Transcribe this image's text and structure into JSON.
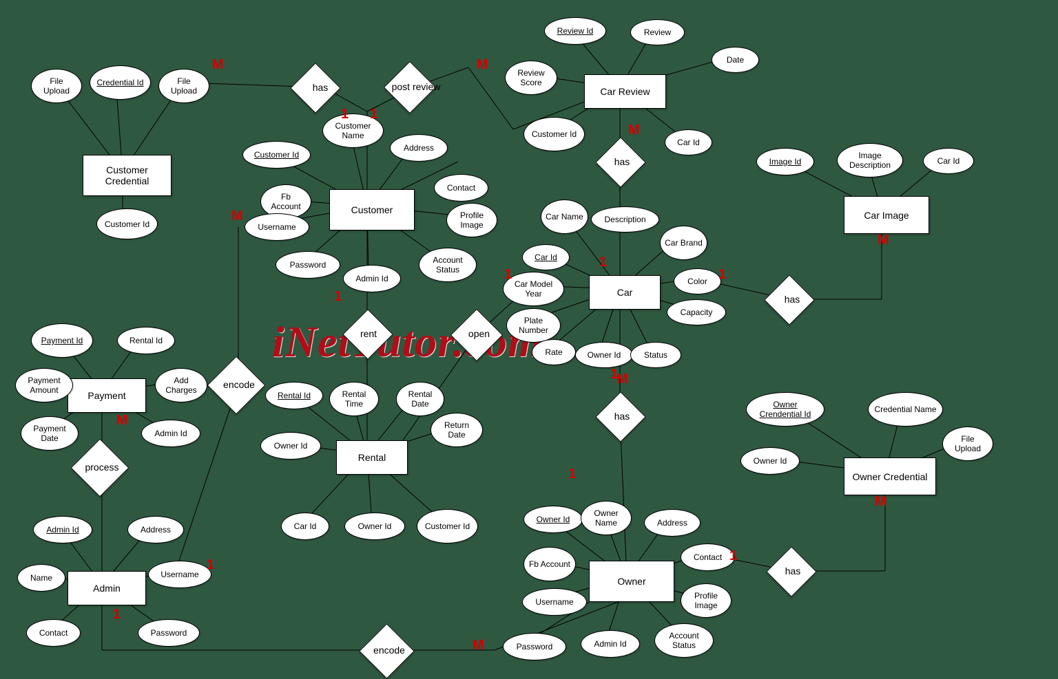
{
  "watermark": "iNetTutor.com",
  "entities": {
    "customer_credential": "Customer Credential",
    "customer": "Customer",
    "car_review": "Car Review",
    "car_image": "Car Image",
    "car": "Car",
    "payment": "Payment",
    "rental": "Rental",
    "admin": "Admin",
    "owner": "Owner",
    "owner_credential": "Owner Credential"
  },
  "relationships": {
    "has1": "has",
    "post_review": "post review",
    "has2": "has",
    "has3": "has",
    "rent": "rent",
    "open": "open",
    "encode1": "encode",
    "process": "process",
    "has4": "has",
    "has5": "has",
    "encode2": "encode"
  },
  "attrs": {
    "cc_file1": "File Upload",
    "cc_credid": "Credential Id",
    "cc_file2": "File Upload",
    "cc_custid": "Customer Id",
    "cu_id": "Customer Id",
    "cu_name": "Customer Name",
    "cu_addr": "Address",
    "cu_fb": "Fb Account",
    "cu_contact": "Contact",
    "cu_user": "Username",
    "cu_profile": "Profile Image",
    "cu_pass": "Password",
    "cu_admin": "Admin Id",
    "cu_status": "Account Status",
    "cr_revid": "Review Id",
    "cr_review": "Review",
    "cr_score": "Review Score",
    "cr_date": "Date",
    "cr_custid": "Customer Id",
    "cr_carid": "Car Id",
    "ci_imgid": "Image Id",
    "ci_desc": "Image Description",
    "ci_carid": "Car Id",
    "car_name": "Car Name",
    "car_desc": "Description",
    "car_id": "Car Id",
    "car_brand": "Car Brand",
    "car_year": "Car Model Year",
    "car_color": "Color",
    "car_plate": "Plate Number",
    "car_cap": "Capacity",
    "car_rate": "Rate",
    "car_owner": "Owner Id",
    "car_status": "Status",
    "pm_id": "Payment Id",
    "pm_rental": "Rental Id",
    "pm_amount": "Payment Amount",
    "pm_charges": "Add Charges",
    "pm_date": "Payment Date",
    "pm_admin": "Admin Id",
    "rn_id": "Rental Id",
    "rn_time": "Rental Time",
    "rn_date": "Rental Date",
    "rn_owner": "Owner Id",
    "rn_return": "Return Date",
    "rn_car": "Car Id",
    "rn_owner2": "Owner Id",
    "rn_cust": "Customer Id",
    "ad_id": "Admin Id",
    "ad_addr": "Address",
    "ad_name": "Name",
    "ad_user": "Username",
    "ad_contact": "Contact",
    "ad_pass": "Password",
    "ow_id": "Owner Id",
    "ow_name": "Owner Name",
    "ow_addr": "Address",
    "ow_fb": "Fb Account",
    "ow_contact": "Contact",
    "ow_user": "Username",
    "ow_profile": "Profile Image",
    "ow_pass": "Password",
    "ow_admin": "Admin Id",
    "ow_status": "Account Status",
    "oc_id": "Owner Crendential Id",
    "oc_name": "Credential Name",
    "oc_owner": "Owner Id",
    "oc_file": "File Upload"
  },
  "card": {
    "m1": "M",
    "one1": "1",
    "one2": "1",
    "m2": "M",
    "m3": "M",
    "m4": "M",
    "one3": "1",
    "one4": "1",
    "one5": "1",
    "one6": "1",
    "m5a": "M",
    "m5": "M",
    "one7": "1",
    "one8": "1",
    "m6": "M",
    "one9": "1",
    "one10": "1",
    "m7": "M",
    "m8": "M"
  }
}
